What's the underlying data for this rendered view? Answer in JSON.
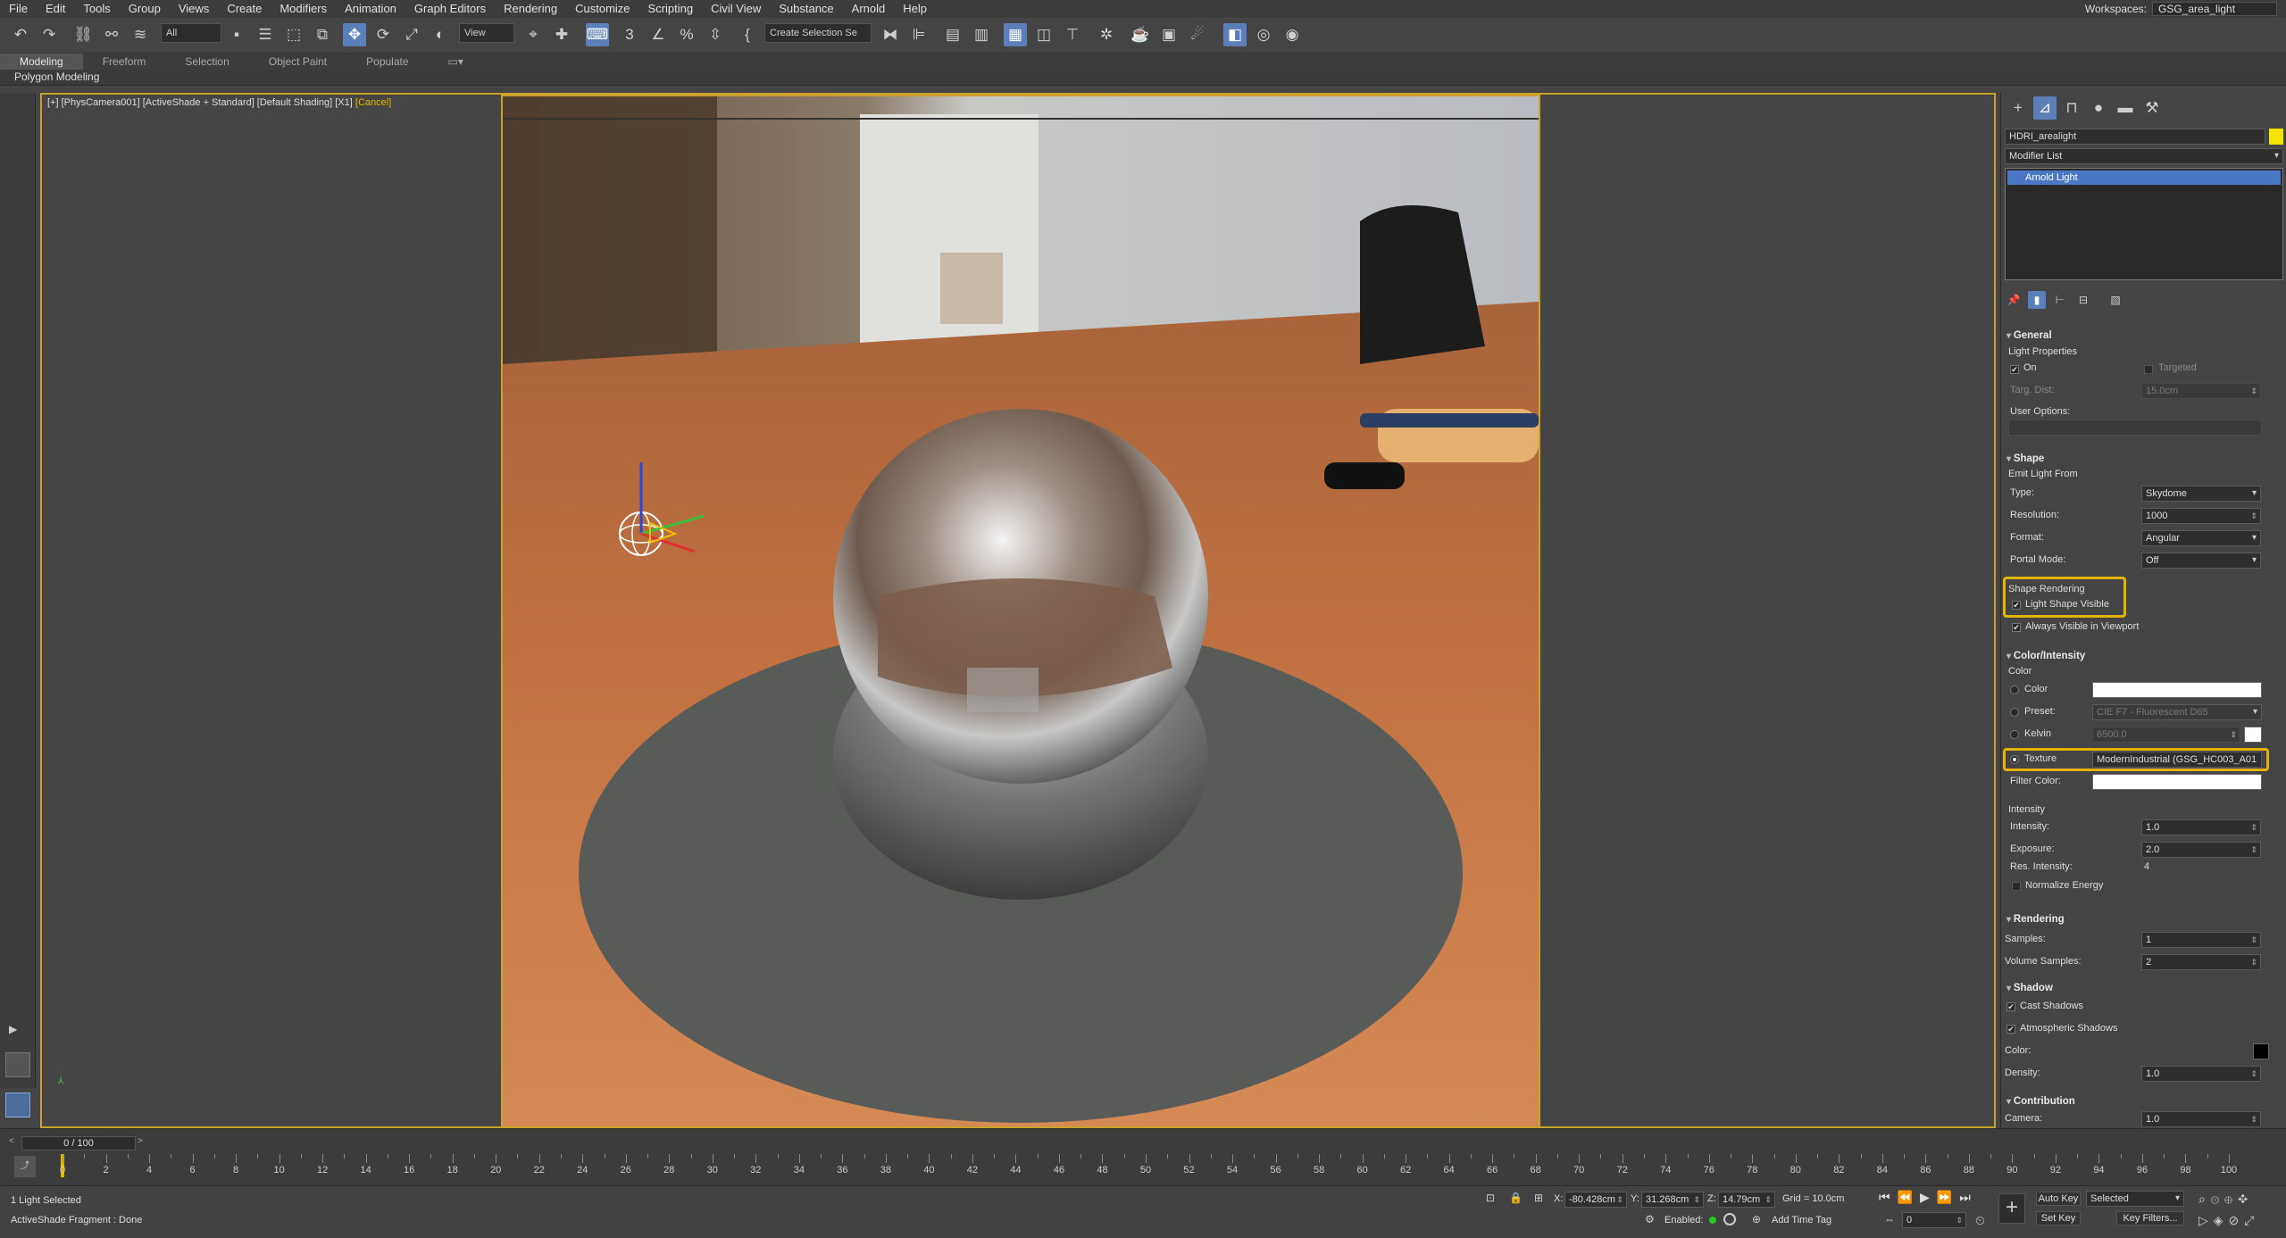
{
  "menu": [
    "File",
    "Edit",
    "Tools",
    "Group",
    "Views",
    "Create",
    "Modifiers",
    "Animation",
    "Graph Editors",
    "Rendering",
    "Customize",
    "Scripting",
    "Civil View",
    "Substance",
    "Arnold",
    "Help"
  ],
  "workspace": {
    "label": "Workspaces:",
    "value": "GSG_area_light"
  },
  "toolbar": {
    "filter": "All",
    "coord": "View",
    "selection_set": "Create Selection Se"
  },
  "ribbon": {
    "tabs": [
      "Modeling",
      "Freeform",
      "Selection",
      "Object Paint",
      "Populate"
    ],
    "active": "Modeling",
    "subtitle": "Polygon Modeling"
  },
  "viewport": {
    "label": "[+] [PhysCamera001] [ActiveShade + Standard] [Default Shading] [X1]",
    "cancel": "[Cancel]"
  },
  "panel": {
    "object_name": "HDRI_arealight",
    "object_color": "#f5e400",
    "modifier_list": "Modifier List",
    "stack_item": "Arnold Light",
    "general": {
      "title": "General",
      "light_props": "Light Properties",
      "on": "On",
      "targeted": "Targeted",
      "targ_dist_label": "Targ. Dist:",
      "targ_dist": "15.0cm",
      "user_options": "User Options:"
    },
    "shape": {
      "title": "Shape",
      "emit": "Emit Light From",
      "type_label": "Type:",
      "type": "Skydome",
      "res_label": "Resolution:",
      "res": "1000",
      "format_label": "Format:",
      "format": "Angular",
      "portal_label": "Portal Mode:",
      "portal": "Off",
      "shape_rendering": "Shape Rendering",
      "light_shape_visible": "Light Shape Visible",
      "always_visible": "Always Visible in Viewport"
    },
    "color": {
      "title": "Color/Intensity",
      "color_hdr": "Color",
      "color_label": "Color",
      "preset_label": "Preset:",
      "preset": "CIE F7 - Fluorescent D65",
      "kelvin_label": "Kelvin",
      "kelvin": "6500.0",
      "texture_label": "Texture",
      "texture": "ModernIndustrial (GSG_HC003_A01",
      "filter_label": "Filter Color:"
    },
    "intensity": {
      "hdr": "Intensity",
      "intensity_label": "Intensity:",
      "intensity": "1.0",
      "exposure_label": "Exposure:",
      "exposure": "2.0",
      "res_label": "Res. Intensity:",
      "res": "4",
      "normalize": "Normalize Energy"
    },
    "rendering": {
      "title": "Rendering",
      "samples_label": "Samples:",
      "samples": "1",
      "vol_label": "Volume Samples:",
      "vol": "2"
    },
    "shadow": {
      "title": "Shadow",
      "cast": "Cast Shadows",
      "atmos": "Atmospheric Shadows",
      "color_label": "Color:",
      "density_label": "Density:",
      "density": "1.0"
    },
    "contribution": {
      "title": "Contribution",
      "camera_label": "Camera:",
      "camera": "1.0"
    }
  },
  "timeline": {
    "frame": "0 / 100",
    "ticks": [
      "0",
      "2",
      "4",
      "6",
      "8",
      "10",
      "12",
      "14",
      "16",
      "18",
      "20",
      "22",
      "24",
      "26",
      "28",
      "30",
      "32",
      "34",
      "36",
      "38",
      "40",
      "42",
      "44",
      "46",
      "48",
      "50",
      "52",
      "54",
      "56",
      "58",
      "60",
      "62",
      "64",
      "66",
      "68",
      "70",
      "72",
      "74",
      "76",
      "78",
      "80",
      "82",
      "84",
      "86",
      "88",
      "90",
      "92",
      "94",
      "96",
      "98",
      "100"
    ]
  },
  "status": {
    "selected": "1 Light Selected",
    "message": "ActiveShade Fragment : Done",
    "x": "-80.428cm",
    "y": "31.268cm",
    "z": "14.79cm",
    "grid": "Grid = 10.0cm",
    "enabled": "Enabled:",
    "add_time_tag": "Add Time Tag",
    "autokey": "Auto Key",
    "selected_dd": "Selected",
    "setkey": "Set Key",
    "keyfilters": "Key Filters...",
    "frame_field": "0"
  }
}
